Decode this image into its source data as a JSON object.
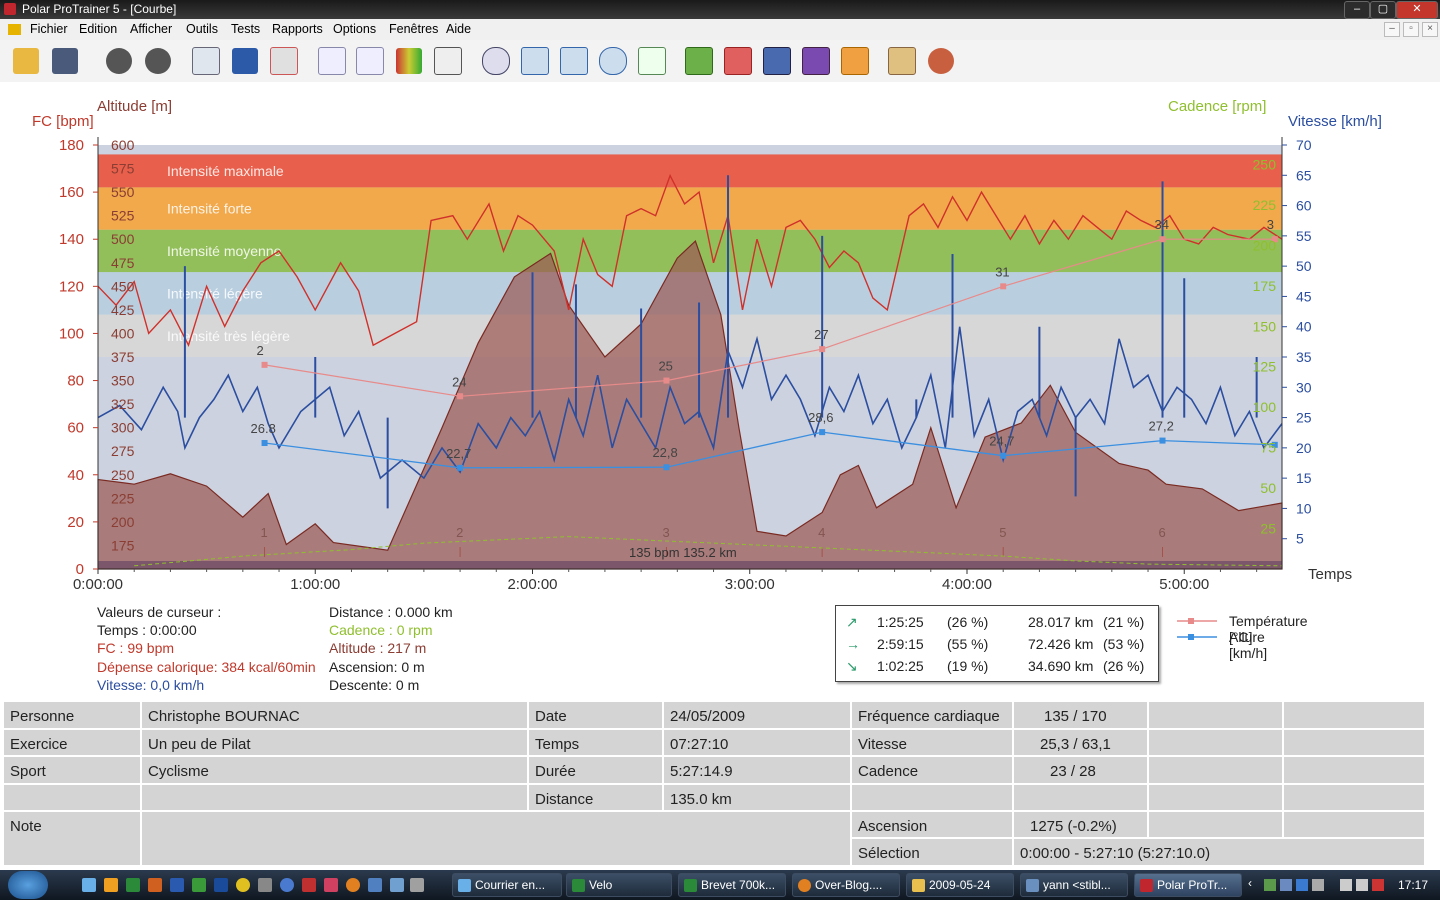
{
  "window": {
    "title": "Polar ProTrainer 5 - [Courbe]",
    "min": "–",
    "max": "▢",
    "close": "✕"
  },
  "menu": [
    "Fichier",
    "Edition",
    "Afficher",
    "Outils",
    "Tests",
    "Rapports",
    "Options",
    "Fenêtres",
    "Aide"
  ],
  "toolbar_icons": [
    "open-folder-icon",
    "save-icon",
    "sync-icon",
    "settings-icon",
    "calendar-icon",
    "book-icon",
    "person-search-icon",
    "line-chart-icon",
    "bar-chart-icon",
    "percent-chart-icon",
    "table-icon",
    "zoom-icon",
    "marker-icon",
    "lap-icon",
    "stopwatch-icon",
    "compare-icon",
    "analysis-1-icon",
    "analysis-2-icon",
    "analysis-3-icon",
    "analysis-4-icon",
    "analysis-5-icon",
    "report-icon",
    "users-icon"
  ],
  "chart_data": {
    "type": "line",
    "axes": {
      "fc_label": "FC [bpm]",
      "fc_ticks": [
        0,
        20,
        40,
        60,
        80,
        100,
        120,
        140,
        160,
        180
      ],
      "alt_label": "Altitude  [m]",
      "alt_ticks": [
        175,
        200,
        225,
        250,
        275,
        300,
        325,
        350,
        375,
        400,
        425,
        450,
        475,
        500,
        525,
        550,
        575,
        600
      ],
      "cad_label": "Cadence [rpm]",
      "cad_ticks": [
        25,
        50,
        75,
        100,
        125,
        150,
        175,
        200,
        225,
        250
      ],
      "speed_label": "Vitesse [km/h]",
      "speed_ticks": [
        5,
        10,
        15,
        20,
        25,
        30,
        35,
        40,
        45,
        50,
        55,
        60,
        65,
        70
      ],
      "time_label": "Temps",
      "time_ticks": [
        "0:00:00",
        "1:00:00",
        "2:00:00",
        "3:00:00",
        "4:00:00",
        "5:00:00"
      ],
      "time_range_min": [
        0,
        327
      ]
    },
    "zones": [
      {
        "name": "Intensité maximale",
        "from": 162,
        "to": 176,
        "color": "#e8604c"
      },
      {
        "name": "Intensité forte",
        "from": 144,
        "to": 162,
        "color": "#f1a94c"
      },
      {
        "name": "Intensité moyenne",
        "from": 126,
        "to": 144,
        "color": "#93bf5b"
      },
      {
        "name": "Intensité légère",
        "from": 108,
        "to": 126,
        "color": "#b9cfe0"
      },
      {
        "name": "Intensité très légère",
        "from": 90,
        "to": 108,
        "color": "#d7d7d7"
      }
    ],
    "laps": [
      {
        "n": "1",
        "t": 46
      },
      {
        "n": "2",
        "t": 100
      },
      {
        "n": "3",
        "t": 157
      },
      {
        "n": "4",
        "t": 200
      },
      {
        "n": "5",
        "t": 250
      },
      {
        "n": "6",
        "t": 294
      }
    ],
    "temperature_c": [
      [
        46,
        26
      ],
      [
        100,
        24
      ],
      [
        157,
        25
      ],
      [
        200,
        27
      ],
      [
        250,
        31
      ],
      [
        294,
        34
      ],
      [
        325,
        34
      ]
    ],
    "pace_kmh": [
      [
        46,
        26.8
      ],
      [
        100,
        22.7
      ],
      [
        157,
        22.8
      ],
      [
        200,
        28.6
      ],
      [
        250,
        24.7
      ],
      [
        294,
        27.2
      ],
      [
        325,
        26.5
      ]
    ],
    "pace_labels": [
      "26.8",
      "22,7",
      "22,8",
      "28,6",
      "24,7",
      "27,2"
    ],
    "temp_labels": [
      "2",
      "24",
      "25",
      "27",
      "31",
      "34",
      "3"
    ],
    "altitude_m": [
      [
        0,
        245
      ],
      [
        10,
        240
      ],
      [
        20,
        251
      ],
      [
        30,
        238
      ],
      [
        40,
        205
      ],
      [
        47,
        230
      ],
      [
        52,
        176
      ],
      [
        60,
        198
      ],
      [
        65,
        178
      ],
      [
        80,
        170
      ],
      [
        95,
        300
      ],
      [
        105,
        390
      ],
      [
        115,
        460
      ],
      [
        125,
        485
      ],
      [
        130,
        430
      ],
      [
        140,
        375
      ],
      [
        150,
        410
      ],
      [
        160,
        480
      ],
      [
        165,
        498
      ],
      [
        172,
        420
      ],
      [
        177,
        300
      ],
      [
        182,
        190
      ],
      [
        190,
        185
      ],
      [
        200,
        210
      ],
      [
        205,
        250
      ],
      [
        210,
        260
      ],
      [
        215,
        215
      ],
      [
        225,
        240
      ],
      [
        230,
        300
      ],
      [
        237,
        215
      ],
      [
        245,
        290
      ],
      [
        255,
        305
      ],
      [
        263,
        345
      ],
      [
        270,
        295
      ],
      [
        282,
        262
      ],
      [
        290,
        255
      ],
      [
        295,
        240
      ],
      [
        305,
        235
      ],
      [
        315,
        212
      ],
      [
        327,
        220
      ]
    ],
    "hr_bpm": [
      [
        0,
        120
      ],
      [
        5,
        112
      ],
      [
        10,
        122
      ],
      [
        14,
        100
      ],
      [
        20,
        110
      ],
      [
        25,
        95
      ],
      [
        30,
        120
      ],
      [
        35,
        103
      ],
      [
        40,
        118
      ],
      [
        45,
        130
      ],
      [
        50,
        135
      ],
      [
        55,
        124
      ],
      [
        60,
        110
      ],
      [
        67,
        130
      ],
      [
        72,
        118
      ],
      [
        76,
        95
      ],
      [
        82,
        100
      ],
      [
        88,
        105
      ],
      [
        92,
        148
      ],
      [
        98,
        150
      ],
      [
        102,
        140
      ],
      [
        108,
        155
      ],
      [
        112,
        135
      ],
      [
        116,
        150
      ],
      [
        120,
        146
      ],
      [
        126,
        135
      ],
      [
        130,
        110
      ],
      [
        134,
        140
      ],
      [
        138,
        125
      ],
      [
        142,
        120
      ],
      [
        146,
        150
      ],
      [
        150,
        153
      ],
      [
        154,
        150
      ],
      [
        158,
        167
      ],
      [
        162,
        155
      ],
      [
        166,
        160
      ],
      [
        170,
        130
      ],
      [
        174,
        150
      ],
      [
        178,
        110
      ],
      [
        182,
        140
      ],
      [
        186,
        120
      ],
      [
        190,
        145
      ],
      [
        194,
        148
      ],
      [
        198,
        140
      ],
      [
        202,
        128
      ],
      [
        206,
        135
      ],
      [
        210,
        130
      ],
      [
        214,
        115
      ],
      [
        218,
        110
      ],
      [
        224,
        150
      ],
      [
        228,
        155
      ],
      [
        232,
        145
      ],
      [
        236,
        158
      ],
      [
        240,
        148
      ],
      [
        244,
        160
      ],
      [
        248,
        150
      ],
      [
        252,
        140
      ],
      [
        256,
        150
      ],
      [
        260,
        138
      ],
      [
        264,
        148
      ],
      [
        268,
        140
      ],
      [
        272,
        150
      ],
      [
        276,
        145
      ],
      [
        280,
        140
      ],
      [
        284,
        152
      ],
      [
        288,
        148
      ],
      [
        292,
        145
      ],
      [
        296,
        150
      ],
      [
        300,
        140
      ],
      [
        304,
        138
      ],
      [
        308,
        145
      ],
      [
        312,
        142
      ],
      [
        318,
        140
      ],
      [
        322,
        145
      ],
      [
        327,
        140
      ]
    ],
    "speed_kmh": [
      [
        0,
        25
      ],
      [
        6,
        27
      ],
      [
        12,
        23
      ],
      [
        18,
        30
      ],
      [
        22,
        26
      ],
      [
        24,
        20
      ],
      [
        28,
        25
      ],
      [
        32,
        28
      ],
      [
        36,
        32
      ],
      [
        40,
        26
      ],
      [
        44,
        30
      ],
      [
        47,
        24
      ],
      [
        50,
        20
      ],
      [
        56,
        26
      ],
      [
        60,
        28
      ],
      [
        64,
        30
      ],
      [
        68,
        22
      ],
      [
        72,
        26
      ],
      [
        78,
        15
      ],
      [
        84,
        18
      ],
      [
        90,
        15
      ],
      [
        95,
        20
      ],
      [
        100,
        16
      ],
      [
        105,
        24
      ],
      [
        110,
        20
      ],
      [
        114,
        25
      ],
      [
        118,
        22
      ],
      [
        122,
        26
      ],
      [
        126,
        18
      ],
      [
        130,
        28
      ],
      [
        134,
        22
      ],
      [
        138,
        32
      ],
      [
        142,
        20
      ],
      [
        146,
        28
      ],
      [
        150,
        24
      ],
      [
        154,
        20
      ],
      [
        158,
        30
      ],
      [
        162,
        24
      ],
      [
        166,
        26
      ],
      [
        170,
        20
      ],
      [
        174,
        36
      ],
      [
        178,
        30
      ],
      [
        182,
        38
      ],
      [
        186,
        28
      ],
      [
        190,
        32
      ],
      [
        194,
        28
      ],
      [
        198,
        22
      ],
      [
        202,
        30
      ],
      [
        206,
        26
      ],
      [
        210,
        32
      ],
      [
        214,
        24
      ],
      [
        218,
        28
      ],
      [
        222,
        20
      ],
      [
        226,
        25
      ],
      [
        230,
        32
      ],
      [
        234,
        20
      ],
      [
        238,
        40
      ],
      [
        242,
        22
      ],
      [
        246,
        28
      ],
      [
        250,
        18
      ],
      [
        254,
        26
      ],
      [
        258,
        28
      ],
      [
        262,
        22
      ],
      [
        266,
        30
      ],
      [
        270,
        25
      ],
      [
        274,
        28
      ],
      [
        278,
        24
      ],
      [
        282,
        38
      ],
      [
        286,
        30
      ],
      [
        290,
        32
      ],
      [
        294,
        26
      ],
      [
        298,
        30
      ],
      [
        302,
        28
      ],
      [
        306,
        24
      ],
      [
        310,
        30
      ],
      [
        314,
        22
      ],
      [
        318,
        26
      ],
      [
        322,
        20
      ],
      [
        327,
        24
      ]
    ],
    "speed_spikes_kmh": [
      [
        24,
        50
      ],
      [
        60,
        35
      ],
      [
        80,
        10
      ],
      [
        120,
        49
      ],
      [
        132,
        47
      ],
      [
        150,
        43
      ],
      [
        166,
        44
      ],
      [
        174,
        65
      ],
      [
        200,
        55
      ],
      [
        226,
        28
      ],
      [
        236,
        52
      ],
      [
        260,
        40
      ],
      [
        270,
        12
      ],
      [
        294,
        64
      ],
      [
        300,
        48
      ],
      [
        320,
        35
      ]
    ],
    "cadence_rpm": [
      [
        10,
        2
      ],
      [
        40,
        8
      ],
      [
        70,
        12
      ],
      [
        90,
        16
      ],
      [
        110,
        18
      ],
      [
        130,
        20
      ],
      [
        150,
        18
      ],
      [
        170,
        16
      ],
      [
        190,
        14
      ],
      [
        210,
        12
      ],
      [
        230,
        10
      ],
      [
        250,
        8
      ],
      [
        270,
        5
      ],
      [
        290,
        3
      ],
      [
        327,
        2
      ]
    ],
    "center_label": "135 bpm 135.2 km"
  },
  "cursor_values": {
    "title": "Valeurs de curseur :",
    "temps": "Temps : 0:00:00",
    "fc": "FC : 99 bpm",
    "depense": "Dépense calorique: 384 kcal/60min",
    "vitesse": "Vitesse: 0,0 km/h",
    "distance": "Distance : 0.000 km",
    "cadence": "Cadence : 0 rpm",
    "altitude": "Altitude : 217 m",
    "ascension": "Ascension: 0 m",
    "descente": "Descente: 0 m"
  },
  "zones_table": [
    {
      "icon": "↗",
      "time": "1:25:25",
      "pct": "(26 %)",
      "dist": "28.017 km",
      "dpct": "(21 %)"
    },
    {
      "icon": "→",
      "time": "2:59:15",
      "pct": "(55 %)",
      "dist": "72.426 km",
      "dpct": "(53 %)"
    },
    {
      "icon": "↘",
      "time": "1:02:25",
      "pct": "(19 %)",
      "dist": "34.690 km",
      "dpct": "(26 %)"
    }
  ],
  "legend2": {
    "temperature": "Température [°C]",
    "allure": "Allure [km/h]"
  },
  "summary": {
    "personne_label": "Personne",
    "personne": "Christophe BOURNAC",
    "exercice_label": "Exercice",
    "exercice": "Un peu de Pilat",
    "sport_label": "Sport",
    "sport": "Cyclisme",
    "note_label": "Note",
    "date_label": "Date",
    "date": "24/05/2009",
    "temps_label": "Temps",
    "temps": "07:27:10",
    "duree_label": "Durée",
    "duree": "5:27:14.9",
    "distance_label": "Distance",
    "distance": "135.0 km",
    "fc_label": "Fréquence cardiaque",
    "fc": "135 / 170",
    "vitesse_label": "Vitesse",
    "vitesse": "25,3 / 63,1",
    "cadence_label": "Cadence",
    "cadence": "23 / 28",
    "ascension_label": "Ascension",
    "ascension": "1275 (-0.2%)",
    "selection_label": "Sélection",
    "selection": "0:00:00 - 5:27:10 (5:27:10.0)"
  },
  "taskbar": {
    "tasks": [
      "Courrier en...",
      "Velo",
      "Brevet 700k...",
      "Over-Blog....",
      "2009-05-24",
      "yann <stibl...",
      "Polar ProTr..."
    ],
    "clock": "17:17"
  },
  "colors": {
    "hr": "#d0302a",
    "speed": "#2b4ea0",
    "cadence": "#8fbf2e",
    "altitude": "#9b5a55",
    "temp": "#e88a8a",
    "pace": "#3b8fe0"
  }
}
